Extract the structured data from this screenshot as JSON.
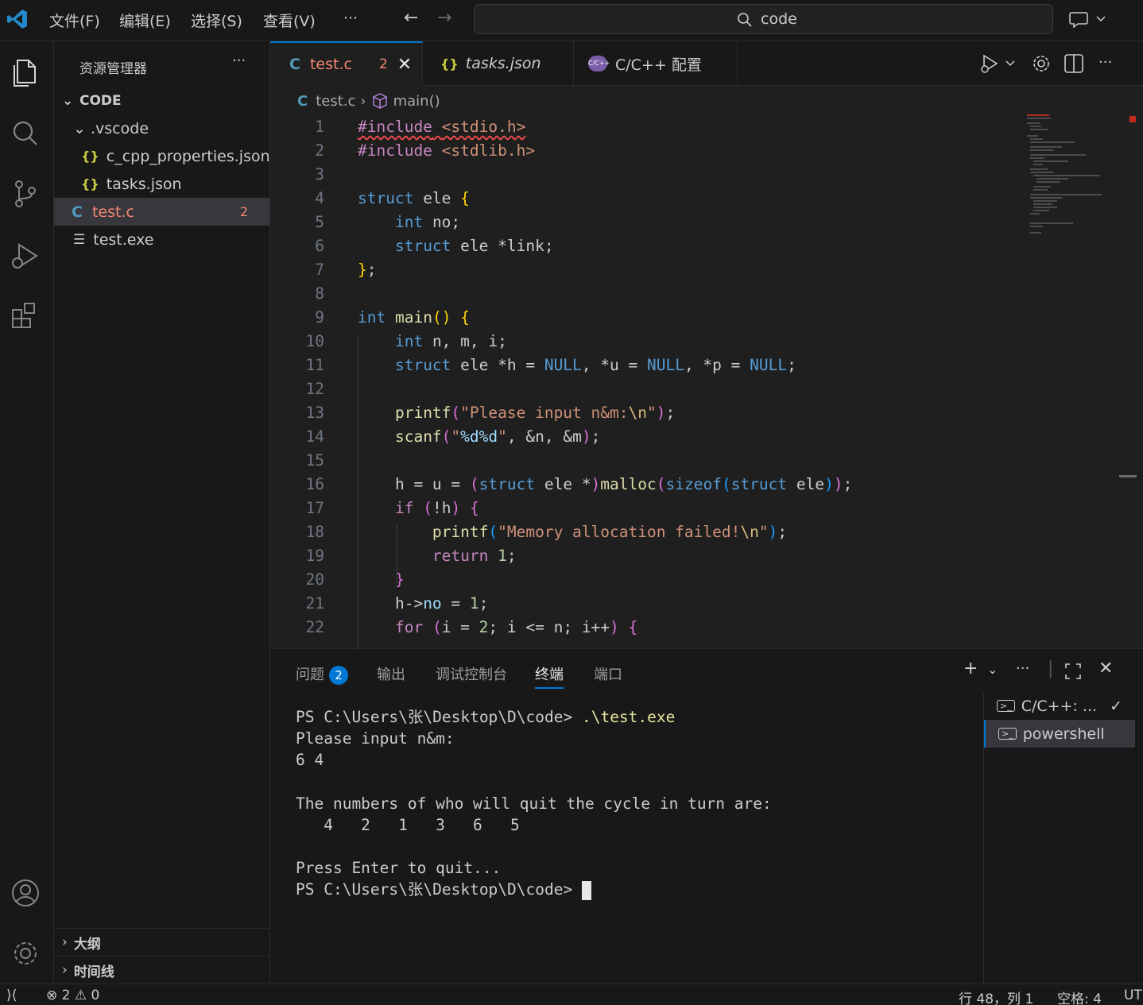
{
  "titlebar": {
    "menus": [
      "文件(F)",
      "编辑(E)",
      "选择(S)",
      "查看(V)",
      "···"
    ],
    "search_text": "code"
  },
  "sidebar": {
    "title": "资源管理器",
    "more": "···",
    "root": "CODE",
    "folder": ".vscode",
    "files": [
      {
        "name": "c_cpp_properties.json",
        "icon": "{}"
      },
      {
        "name": "tasks.json",
        "icon": "{}"
      }
    ],
    "selected_file": "test.c",
    "selected_badge": "2",
    "exe_file": "test.exe",
    "outline": "大纲",
    "timeline": "时间线"
  },
  "tabs": [
    {
      "label": "test.c",
      "badge": "2",
      "icon": "C"
    },
    {
      "label": "tasks.json",
      "icon": "{}"
    },
    {
      "label": "C/C++ 配置",
      "icon": "C/C++"
    }
  ],
  "breadcrumb": {
    "file": "test.c",
    "symbol": "main()"
  },
  "panel": {
    "tabs": [
      "问题",
      "输出",
      "调试控制台",
      "终端",
      "端口"
    ],
    "problems_count": "2",
    "terminals": [
      "C/C++: ...",
      "powershell"
    ],
    "output": [
      {
        "prompt": "PS C:\\Users\\张\\Desktop\\D\\code> ",
        "cmd": ".\\test.exe"
      },
      {
        "text": "Please input n&m:"
      },
      {
        "text": "6 4"
      },
      {
        "text": ""
      },
      {
        "text": "The numbers of who will quit the cycle in turn are:"
      },
      {
        "text": "   4   2   1   3   6   5"
      },
      {
        "text": ""
      },
      {
        "text": "Press Enter to quit..."
      },
      {
        "prompt": "PS C:\\Users\\张\\Desktop\\D\\code> ",
        "cmd": ""
      }
    ]
  },
  "statusbar": {
    "errors": "2",
    "warnings": "0",
    "position": "行 48，列 1",
    "spaces": "空格: 4",
    "encoding": "UT"
  },
  "colors": {
    "accent": "#0078d4",
    "error": "#f48771"
  }
}
